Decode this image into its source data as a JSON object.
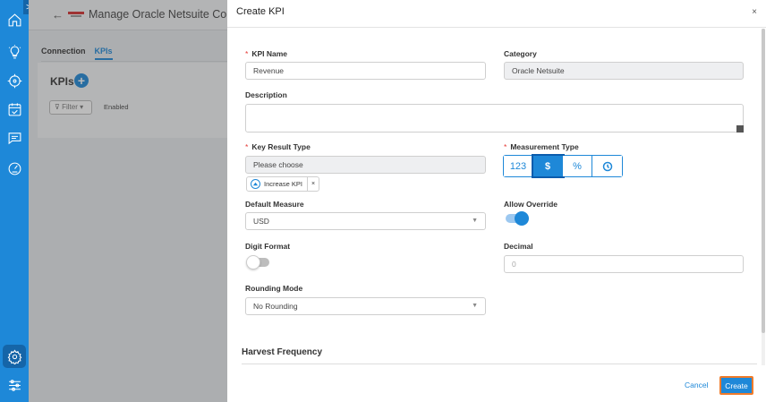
{
  "background": {
    "back_arrow": "←",
    "title": "Manage Oracle Netsuite Connec",
    "tabs": [
      {
        "label": "Connection"
      },
      {
        "label": "KPIs"
      }
    ],
    "kpis_heading": "KPIs",
    "add_symbol": "+",
    "filter_label": "Filter",
    "enabled_label": "Enabled"
  },
  "sidebar": {
    "toggle": ">",
    "icons": [
      "home-icon",
      "lightbulb-icon",
      "compass-icon",
      "calendar-check-icon",
      "chat-icon",
      "gauge-icon",
      "settings-icon",
      "sliders-icon"
    ]
  },
  "modal": {
    "title": "Create KPI",
    "close": "×",
    "kpi_name": {
      "label": "KPI Name",
      "value": "Revenue"
    },
    "category": {
      "label": "Category",
      "value": "Oracle Netsuite"
    },
    "description": {
      "label": "Description",
      "value": ""
    },
    "key_result_type": {
      "label": "Key Result Type",
      "value": "Please choose",
      "chip": "Increase KPI",
      "chip_remove": "×"
    },
    "measurement_type": {
      "label": "Measurement Type",
      "options": [
        "123",
        "$",
        "%"
      ],
      "selected": "$",
      "last_icon": "clock-icon"
    },
    "default_measure": {
      "label": "Default Measure",
      "value": "USD"
    },
    "allow_override": {
      "label": "Allow Override",
      "on": true
    },
    "digit_format": {
      "label": "Digit Format",
      "on": false
    },
    "decimal": {
      "label": "Decimal",
      "placeholder": "0"
    },
    "rounding_mode": {
      "label": "Rounding Mode",
      "value": "No Rounding"
    },
    "harvest_frequency": "Harvest Frequency",
    "required_mark": "*",
    "cancel_label": "Cancel",
    "create_label": "Create"
  },
  "colors": {
    "accent": "#1e88d8",
    "sidebar": "#1e88d8",
    "create_border": "#f07b2a",
    "required": "#e53935"
  }
}
